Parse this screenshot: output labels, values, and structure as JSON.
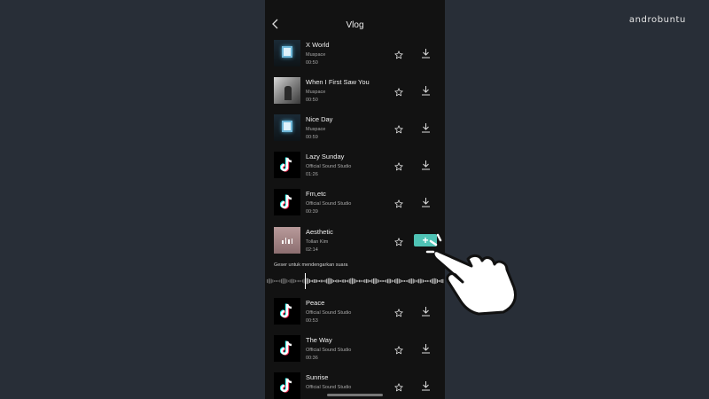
{
  "watermark": "androbuntu",
  "header": {
    "title": "Vlog"
  },
  "tracks": [
    {
      "name": "X World",
      "artist": "Muspace",
      "duration": "00:50",
      "thumb": "xworld"
    },
    {
      "name": "When I First Saw You",
      "artist": "Muspace",
      "duration": "00:50",
      "thumb": "photo"
    },
    {
      "name": "Nice Day",
      "artist": "Muspace",
      "duration": "00:59",
      "thumb": "xworld"
    },
    {
      "name": "Lazy Sunday",
      "artist": "Official Sound Studio",
      "duration": "01:26",
      "thumb": "tiktok"
    },
    {
      "name": "Fm,etc",
      "artist": "Official Sound Studio",
      "duration": "00:39",
      "thumb": "tiktok"
    },
    {
      "name": "Aesthetic",
      "artist": "Tollan Kim",
      "duration": "02:14",
      "thumb": "aesthetic",
      "selected": true
    },
    {
      "name": "Peace",
      "artist": "Official Sound Studio",
      "duration": "00:53",
      "thumb": "tiktok"
    },
    {
      "name": "The Way",
      "artist": "Official Sound Studio",
      "duration": "00:36",
      "thumb": "tiktok"
    },
    {
      "name": "Sunrise",
      "artist": "Official Sound Studio",
      "duration": "",
      "thumb": "tiktok"
    }
  ],
  "selected_track": {
    "hint": "Geser untuk mendengarkan suara",
    "add_label": "+"
  },
  "colors": {
    "accent": "#4fc3b5",
    "background": "#121212",
    "page": "#282e37"
  },
  "icons": {
    "back": "chevron-left-icon",
    "favorite": "star-icon",
    "download": "download-icon",
    "add": "plus-icon",
    "pointer": "hand-pointer-icon"
  }
}
